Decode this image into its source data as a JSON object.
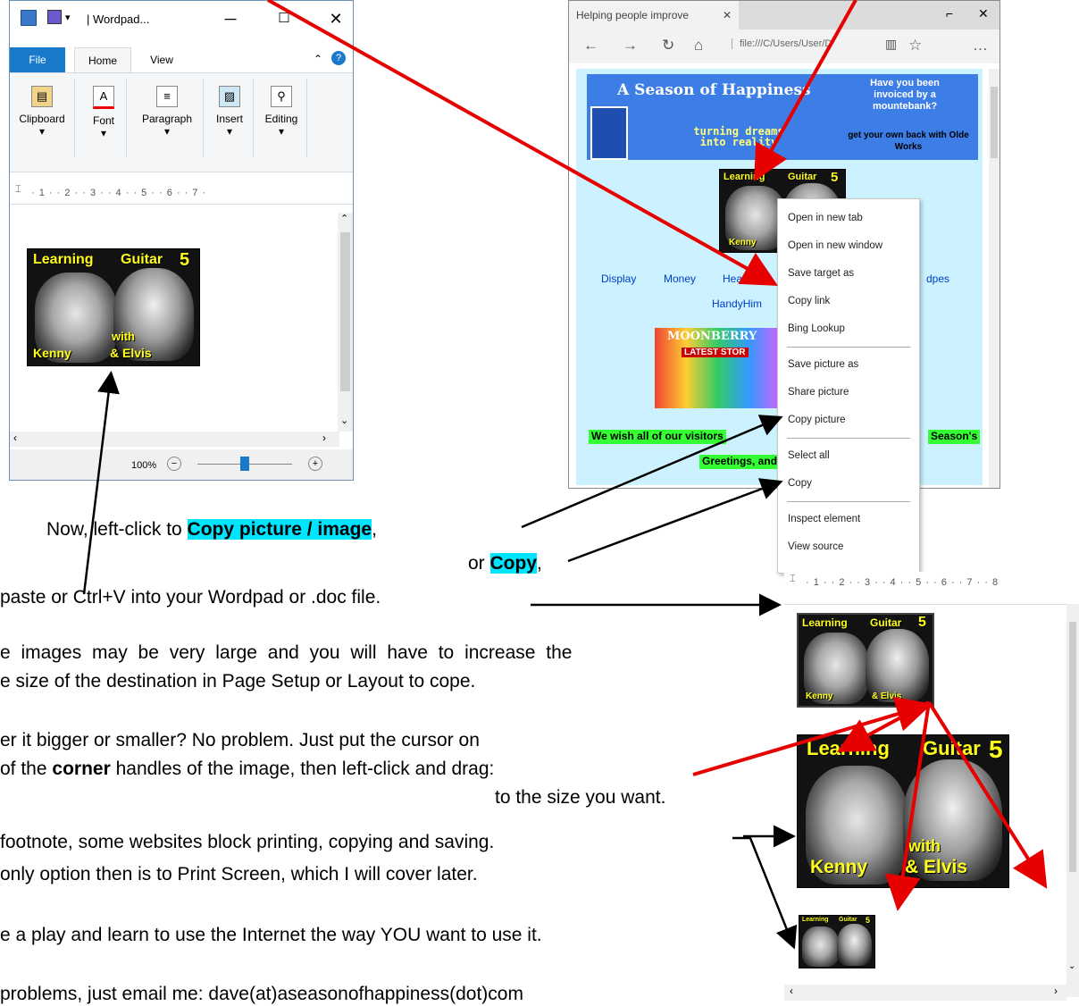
{
  "wordpad": {
    "title": "Wordpad...",
    "title_prefix": "| ",
    "tabs": [
      "File",
      "Home",
      "View"
    ],
    "groups": [
      "Clipboard",
      "Font",
      "Paragraph",
      "Insert",
      "Editing"
    ],
    "ruler": "· 1 · · 2 · · 3 · · 4 · · 5 · · 6 · · 7 ·",
    "zoom": "100%"
  },
  "guitar_image": {
    "line1a": "Learning",
    "line1b": "Guitar",
    "number": "5",
    "line2a": "Kenny",
    "line2b": "with",
    "line2c": "& Elvis"
  },
  "browser": {
    "tab_title": "Helping people improve",
    "address": "file:///C/Users/User/D",
    "banner_title": "A Season of Happiness",
    "banner_tag": "turning dreams into reality",
    "banner_right1": "Have you been invoiced by a mountebank?",
    "banner_right2": "get your own back with Olde Works",
    "links": [
      "Display",
      "Money",
      "Health",
      "dpes"
    ],
    "link2": "HandyHim",
    "moonberry": "MOONBERRY",
    "latest": "LATEST STOR",
    "greeting1": "We wish all of our visitors",
    "greeting1b": "Season's",
    "greeting2": "Greetings, and a Ha"
  },
  "context_menu": {
    "items": [
      "Open in new tab",
      "Open in new window",
      "Save target as",
      "Copy link",
      "Bing Lookup",
      "Save picture as",
      "Share picture",
      "Copy picture",
      "Select all",
      "Copy",
      "Inspect element",
      "View source"
    ]
  },
  "instructions": {
    "line1_pre": "Now, left-click to ",
    "line1_hl": "Copy picture / image",
    "line1_post": ",",
    "line2_pre": "or ",
    "line2_hl": "Copy",
    "line2_post": ",",
    "line3": "paste or Ctrl+V into your Wordpad or .doc file.",
    "line4": "e images may be very large and you will have to increase the",
    "line5": "e size of the destination in Page Setup or Layout to cope.",
    "line6": "er it bigger or smaller?  No problem.  Just put the cursor on",
    "line7_pre": "of the ",
    "line7_b": "corner",
    "line7_post": " handles of the image, then left-click and drag:",
    "line8": "to the size you want.",
    "line9": "footnote, some websites block printing, copying and saving.",
    "line10": "only option then is to Print Screen, which I will cover later.",
    "line11": "e a play and learn to use the Internet the way YOU want to use it.",
    "line12": "problems, just email me: dave(at)aseasonofhappiness(dot)com"
  },
  "right_doc": {
    "ruler": "· 1 · · 2 · · 3 · · 4 · · 5 · · 6 · · 7 · · 8"
  },
  "colors": {
    "highlight": "#00e5ff",
    "arrow_red": "#e60000",
    "caption_yellow": "#ffff1a"
  }
}
